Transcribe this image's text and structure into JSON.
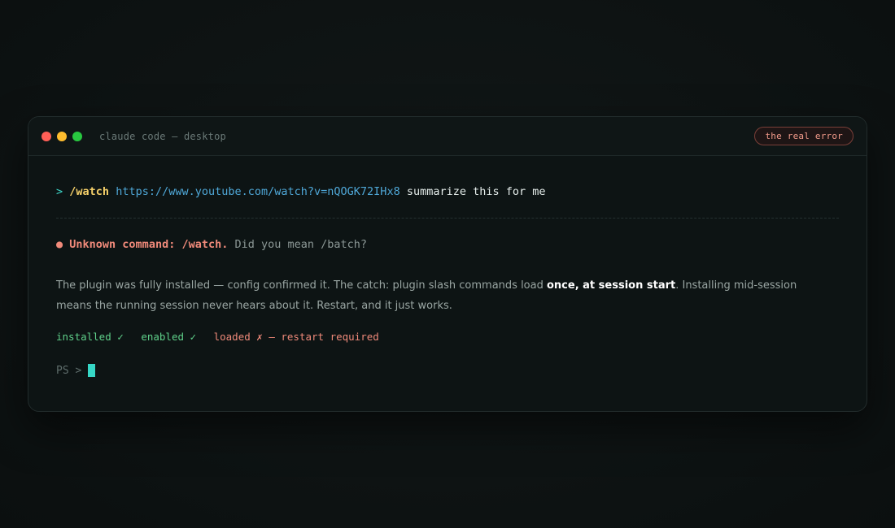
{
  "window": {
    "title": "claude code — desktop",
    "badge": "the real error"
  },
  "command": {
    "prompt": ">",
    "slash": "/watch",
    "url": "https://www.youtube.com/watch?v=nQOGK72IHx8",
    "args": "summarize this for me"
  },
  "error": {
    "bullet": "●",
    "strong": "Unknown command: /watch.",
    "rest": "Did you mean /batch?"
  },
  "explanation": {
    "before": "The plugin was fully installed — config confirmed it. The catch: plugin slash commands load ",
    "emphasis": "once, at session start",
    "after": ". Installing mid-session means the running session never hears about it. Restart, and it just works."
  },
  "status": {
    "installed": "installed ✓",
    "enabled": "enabled ✓",
    "loaded": "loaded ✗ — restart required"
  },
  "shell": {
    "prompt": "PS >"
  },
  "colors": {
    "accent": "#36d7c6",
    "error": "#f08a7a",
    "success": "#5fd08a",
    "url": "#4fa8d8",
    "command": "#f5d06a"
  }
}
